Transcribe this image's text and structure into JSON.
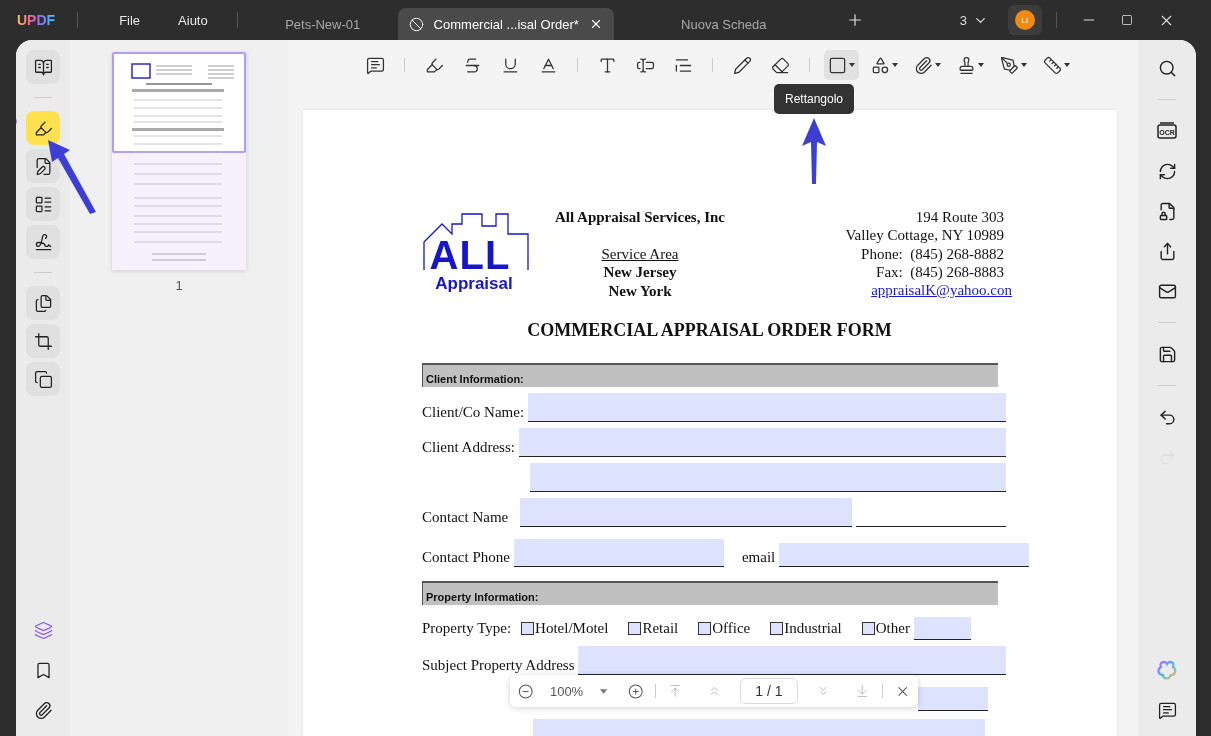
{
  "app": {
    "logo": "UPDF",
    "menu": [
      {
        "label": "File"
      },
      {
        "label": "Aiuto"
      }
    ]
  },
  "tabs": [
    {
      "label": "Pets-New-01",
      "selected": false
    },
    {
      "label": "Commercial ...isal Order*",
      "selected": true
    },
    {
      "label": "Nuova Scheda",
      "selected": false
    }
  ],
  "tab_count": "3",
  "avatar": "LI",
  "left_tools": [
    [
      {
        "kind": "reader",
        "selected": false
      }
    ],
    [
      {
        "kind": "highlight",
        "selected": true
      },
      {
        "kind": "edit",
        "selected": false
      },
      {
        "kind": "organize",
        "selected": false
      },
      {
        "kind": "sign",
        "selected": false
      }
    ],
    [
      {
        "kind": "pages",
        "selected": false
      },
      {
        "kind": "crop",
        "selected": false
      },
      {
        "kind": "copy",
        "selected": false
      }
    ]
  ],
  "left_bottom": [
    {
      "kind": "layers"
    },
    {
      "kind": "bookmark"
    },
    {
      "kind": "attachment"
    }
  ],
  "thumbnails": [
    {
      "page": "1",
      "selected": true
    }
  ],
  "toolbar": [
    [
      {
        "kind": "comment",
        "selected": false,
        "menu": false
      }
    ],
    [
      {
        "kind": "highlight",
        "selected": false,
        "menu": false
      },
      {
        "kind": "strikethrough",
        "selected": false,
        "menu": false
      },
      {
        "kind": "underline",
        "selected": false,
        "menu": false
      },
      {
        "kind": "squiggly",
        "selected": false,
        "menu": false
      }
    ],
    [
      {
        "kind": "text",
        "selected": false,
        "menu": false
      },
      {
        "kind": "textbox",
        "selected": false,
        "menu": false
      },
      {
        "kind": "callout",
        "selected": false,
        "menu": false
      }
    ],
    [
      {
        "kind": "pencil",
        "selected": false,
        "menu": false
      },
      {
        "kind": "eraser",
        "selected": false,
        "menu": false
      }
    ],
    [
      {
        "kind": "rectangle",
        "selected": true,
        "menu": true
      },
      {
        "kind": "shape",
        "selected": false,
        "menu": true
      },
      {
        "kind": "attach",
        "selected": false,
        "menu": true
      },
      {
        "kind": "stamp",
        "selected": false,
        "menu": true
      },
      {
        "kind": "pen",
        "selected": false,
        "menu": true
      },
      {
        "kind": "measure",
        "selected": false,
        "menu": true
      }
    ]
  ],
  "tooltip": "Rettangolo",
  "right_tools": [
    [
      {
        "kind": "search",
        "disabled": false
      }
    ],
    [
      {
        "kind": "ocr",
        "disabled": false
      },
      {
        "kind": "convert",
        "disabled": false
      },
      {
        "kind": "protect",
        "disabled": false
      },
      {
        "kind": "share",
        "disabled": false
      },
      {
        "kind": "mail",
        "disabled": false
      }
    ],
    [
      {
        "kind": "save",
        "disabled": false
      }
    ],
    [
      {
        "kind": "undo",
        "disabled": false
      },
      {
        "kind": "redo",
        "disabled": true
      }
    ]
  ],
  "ocr_label": "OCR",
  "right_bottom": [
    {
      "kind": "ai"
    },
    {
      "kind": "comment"
    }
  ],
  "document": {
    "logo": {
      "top": "ALL",
      "bottom": "Appraisal"
    },
    "company": "All Appraisal Services, Inc",
    "service_area_title": "Service Area",
    "service_areas": [
      "New Jersey",
      "New York"
    ],
    "address": [
      "194 Route 303",
      "Valley Cottage, NY 10989",
      "Phone:  (845) 268-8882",
      "Fax:  (845) 268-8883"
    ],
    "email": "appraisalK@yahoo.con",
    "title": "COMMERCIAL APPRAISAL ORDER FORM",
    "sections": [
      {
        "title": "Client Information:",
        "rows": [
          {
            "kind": "field",
            "label": "Client/Co Name:"
          },
          {
            "kind": "field",
            "label": "Client Address:"
          },
          {
            "kind": "field"
          },
          {
            "kind": "short",
            "label": "Contact Name"
          },
          {
            "kind": "pair",
            "label": "Contact Phone",
            "label2": "email"
          }
        ]
      },
      {
        "title": "Property Information:",
        "rows": [
          {
            "kind": "checks",
            "label": "Property Type:",
            "options": [
              {
                "label": "Hotel/Motel",
                "checked": false
              },
              {
                "label": "Retail",
                "checked": false
              },
              {
                "label": "Office",
                "checked": false
              },
              {
                "label": "Industrial",
                "checked": false
              },
              {
                "label": "Other",
                "checked": false
              }
            ]
          },
          {
            "kind": "field",
            "label": "Subject Property Address"
          },
          {
            "kind": "blank"
          }
        ]
      }
    ]
  },
  "page_nav": {
    "zoom": "100%",
    "page": "1 / 1"
  }
}
